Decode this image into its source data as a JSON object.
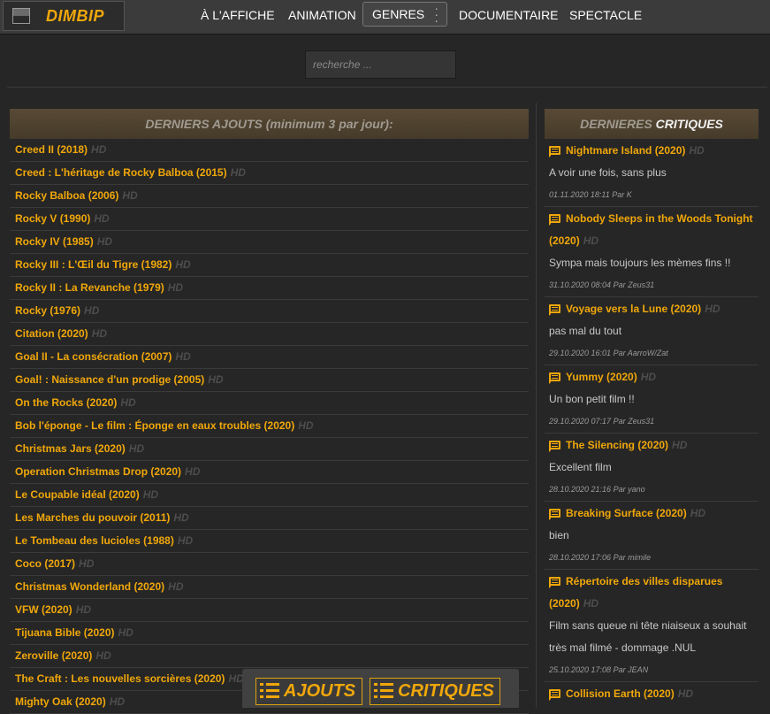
{
  "brand": {
    "name": "DIMBIP"
  },
  "nav": {
    "items": [
      "À L'AFFICHE",
      "ANIMATION"
    ],
    "genres": "GENRES",
    "items_after": [
      "DOCUMENTAIRE",
      "SPECTACLE"
    ]
  },
  "search": {
    "placeholder": "recherche ..."
  },
  "latest": {
    "title": "DERNIERS AJOUTS (minimum 3 par jour):",
    "badge": "HD",
    "items": [
      "Creed II (2018)",
      "Creed : L'héritage de Rocky Balboa (2015)",
      "Rocky Balboa (2006)",
      "Rocky V (1990)",
      "Rocky IV (1985)",
      "Rocky III : L'Œil du Tigre (1982)",
      "Rocky II : La Revanche (1979)",
      "Rocky (1976)",
      "Citation (2020)",
      "Goal II - La consécration (2007)",
      "Goal! : Naissance d'un prodige (2005)",
      "On the Rocks (2020)",
      "Bob l'éponge - Le film : Éponge en eaux troubles (2020)",
      "Christmas Jars (2020)",
      "Operation Christmas Drop (2020)",
      "Le Coupable idéal (2020)",
      "Les Marches du pouvoir (2011)",
      "Le Tombeau des lucioles (1988)",
      "Coco (2017)",
      "Christmas Wonderland (2020)",
      "VFW (2020)",
      "Tijuana Bible (2020)",
      "Zeroville (2020)",
      "The Craft : Les nouvelles sorcières (2020)",
      "Mighty Oak (2020)"
    ]
  },
  "critiques": {
    "title_a": "DERNIERES",
    "title_b": "CRITIQUES",
    "badge": "HD",
    "items": [
      {
        "title": "Nightmare Island (2020)",
        "text": "A voir une fois, sans plus",
        "meta": "01.11.2020 18:11 Par K"
      },
      {
        "title": "Nobody Sleeps in the Woods Tonight (2020)",
        "text": "Sympa mais toujours les mèmes fins !!",
        "meta": "31.10.2020 08:04 Par Zeus31"
      },
      {
        "title": "Voyage vers la Lune (2020)",
        "text": "pas mal du tout",
        "meta": "29.10.2020 16:01 Par AarroW/Zat"
      },
      {
        "title": "Yummy (2020)",
        "text": "Un bon petit film !!",
        "meta": "29.10.2020 07:17 Par Zeus31"
      },
      {
        "title": "The Silencing (2020)",
        "text": "Excellent film",
        "meta": "28.10.2020 21:16 Par yano"
      },
      {
        "title": "Breaking Surface (2020)",
        "text": "bien",
        "meta": "28.10.2020 17:06 Par mimile"
      },
      {
        "title": "Répertoire des villes disparues (2020)",
        "text": "Film sans queue ni tête niaiseux a souhait très mal filmé - dommage .NUL",
        "meta": "25.10.2020 17:08 Par JEAN"
      },
      {
        "title": "Collision Earth (2020)",
        "text": "",
        "meta": ""
      }
    ]
  },
  "bottom": {
    "tab1": "AJOUTS",
    "tab2": "CRITIQUES"
  },
  "colors": {
    "accent": "#f0a70a",
    "background": "#262626",
    "topbar": "#3b3b3b"
  }
}
